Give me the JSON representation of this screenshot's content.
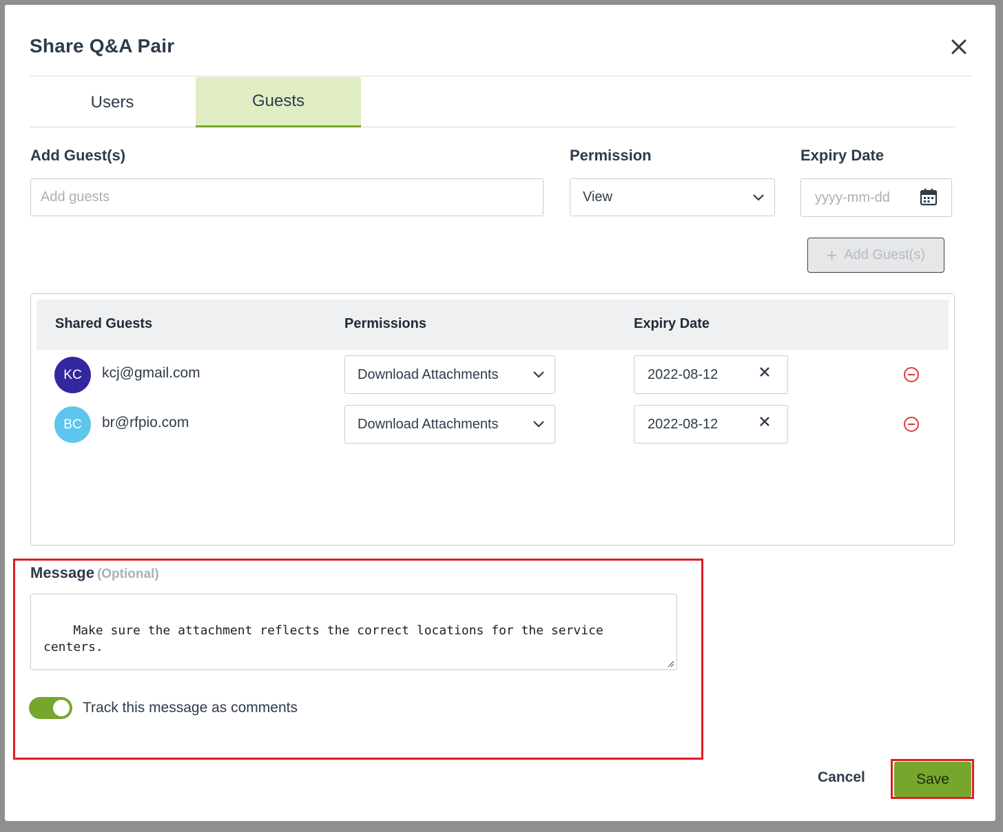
{
  "modal": {
    "title": "Share Q&A Pair"
  },
  "tabs": [
    {
      "label": "Users",
      "active": false
    },
    {
      "label": "Guests",
      "active": true
    }
  ],
  "add_guest": {
    "label": "Add Guest(s)",
    "placeholder": "Add guests",
    "value": ""
  },
  "permission": {
    "label": "Permission",
    "selected": "View"
  },
  "expiry": {
    "label": "Expiry Date",
    "placeholder": "yyyy-mm-dd"
  },
  "add_guest_button": {
    "label": "Add Guest(s)",
    "disabled": true
  },
  "table": {
    "headers": [
      "Shared Guests",
      "Permissions",
      "Expiry Date"
    ],
    "rows": [
      {
        "initials": "KC",
        "avatar_color": "#3327a0",
        "email": "kcj@gmail.com",
        "permission": "Download Attachments",
        "expiry": "2022-08-12"
      },
      {
        "initials": "BC",
        "avatar_color": "#5ec6ec",
        "email": "br@rfpio.com",
        "permission": "Download Attachments",
        "expiry": "2022-08-12"
      }
    ]
  },
  "message": {
    "label": "Message",
    "optional": "(Optional)",
    "text": "Make sure the attachment reflects the correct locations for the service\ncenters."
  },
  "track_toggle": {
    "label": "Track this message as comments",
    "on": true
  },
  "footer": {
    "cancel": "Cancel",
    "save": "Save"
  },
  "colors": {
    "accent": "#77a62c",
    "highlight": "#e01b24",
    "remove": "#e03a3a"
  }
}
